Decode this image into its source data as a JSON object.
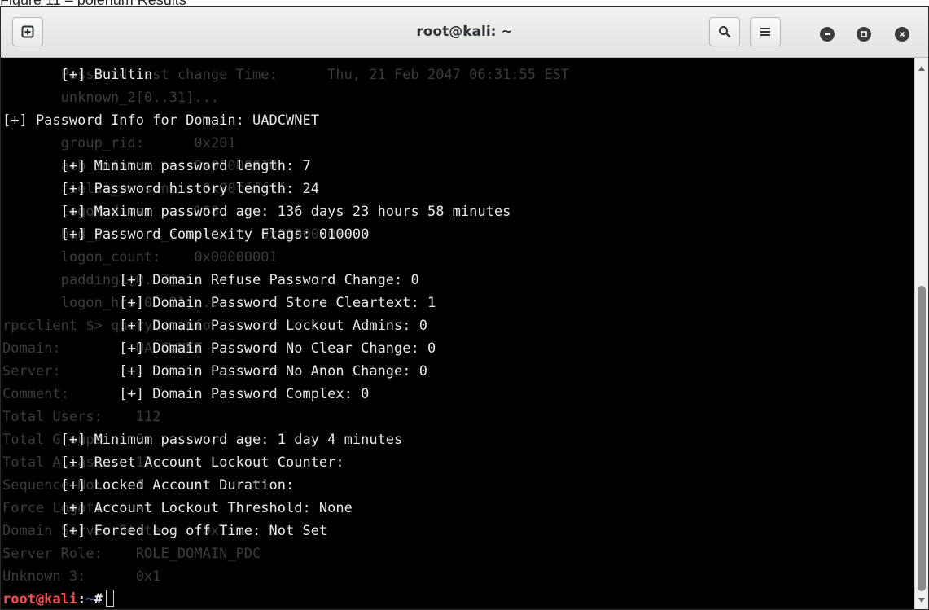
{
  "caption": "Figure 11 – polenum Results",
  "window": {
    "title": "root@kali: ~",
    "buttons": {
      "new_tab_icon": "plus-square-icon",
      "search_icon": "search-icon",
      "menu_icon": "hamburger-menu-icon",
      "minimize_icon": "minimize-icon",
      "maximize_icon": "maximize-icon",
      "close_icon": "close-icon"
    }
  },
  "terminal": {
    "prompt_user": "root@kali",
    "prompt_path": "~",
    "prompt_suffix": "#",
    "lines": [
      {
        "ghost": "       Password last change Time:      Thu, 21 Feb 2047 06:31:55 EST",
        "text": "       [+] Builtin"
      },
      {
        "ghost": "       unknown_2[0..31]...",
        "text": ""
      },
      {
        "ghost": "",
        "text": "[+] Password Info for Domain: UADCWNET"
      },
      {
        "ghost": "       group_rid:      0x201",
        "text": ""
      },
      {
        "ghost": "       acb_info :      0x00000010",
        "text": "       [+] Minimum password length: 7"
      },
      {
        "ghost": "       fields_present:  0x00ffffff",
        "text": "       [+] Password history length: 24"
      },
      {
        "ghost": "       logon_divs:     168",
        "text": "       [+] Maximum password age: 136 days 23 hours 58 minutes"
      },
      {
        "ghost": "       bad_password_count:     0x00000000",
        "text": "       [+] Password Complexity Flags: 010000"
      },
      {
        "ghost": "       logon_count:    0x00000001",
        "text": ""
      },
      {
        "ghost": "       padding1[0..7]...",
        "text": "              [+] Domain Refuse Password Change: 0"
      },
      {
        "ghost": "       logon_hrs[0..21]...",
        "text": "              [+] Domain Password Store Cleartext: 1"
      },
      {
        "ghost": "rpcclient $> querydominfo",
        "text": "              [+] Domain Password Lockout Admins: 0"
      },
      {
        "ghost": "Domain:         UADCWNET",
        "text": "              [+] Domain Password No Clear Change: 0"
      },
      {
        "ghost": "Server:",
        "text": "              [+] Domain Password No Anon Change: 0"
      },
      {
        "ghost": "Comment:",
        "text": "              [+] Domain Password Complex: 0"
      },
      {
        "ghost": "Total Users:    112",
        "text": ""
      },
      {
        "ghost": "Total Groups:   0",
        "text": "       [+] Minimum password age: 1 day 4 minutes"
      },
      {
        "ghost": "Total Aliases:  17",
        "text": "       [+] Reset Account Lockout Counter:"
      },
      {
        "ghost": "Sequence No:    1",
        "text": "       [+] Locked Account Duration:"
      },
      {
        "ghost": "Force Logoff:   -1",
        "text": "       [+] Account Lockout Threshold: None"
      },
      {
        "ghost": "Domain Server State:    0x1",
        "text": "       [+] Forced Log off Time: Not Set"
      },
      {
        "ghost": "Server Role:    ROLE_DOMAIN_PDC",
        "text": ""
      },
      {
        "ghost": "Unknown 3:      0x1",
        "text": ""
      }
    ]
  }
}
